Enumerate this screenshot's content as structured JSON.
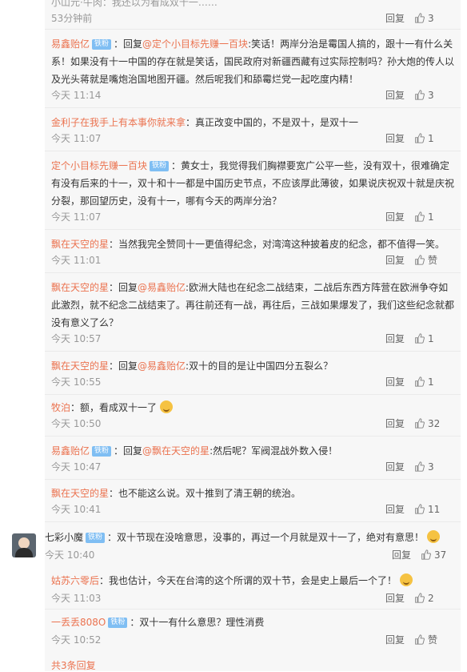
{
  "first": {
    "partial_text": "小山元·牛肉：我还以为看成双十一……",
    "time": "53分钟前",
    "reply": "回复",
    "likes": "3"
  },
  "comments": [
    {
      "user": "易鑫贻亿",
      "badge": "铁粉",
      "prefix": "：回复",
      "mention": "@定个小目标先赚一百块",
      "text": ":笑话！两岸分治是霉国人搞的，跟十一有什么关系！如果没有十一中国的存在就是笑话，国民政府对新疆西藏有过实际控制吗？孙大炮的传人以及光头蒋就是嘴炮治国地图开疆。然后呢我们和舔霉烂党一起吃度内精！",
      "time": "今天 11:14",
      "reply": "回复",
      "likes": "3"
    },
    {
      "user": "金利子在我手上有本事你就来拿",
      "badge": "",
      "prefix": "",
      "mention": "",
      "text": "：真正改变中国的，不是双十，是双十一",
      "time": "今天 11:07",
      "reply": "回复",
      "likes": "1"
    },
    {
      "user": "定个小目标先赚一百块",
      "badge": "铁粉",
      "prefix": "",
      "mention": "",
      "text": "：黄女士，我觉得我们胸襟要宽广公平一些，没有双十，很难确定有没有后来的十一，双十和十一都是中国历史节点，不应该厚此薄彼，如果说庆祝双十就是庆祝分裂，那回望历史，没有十一，哪有今天的两岸分治？",
      "time": "今天 11:07",
      "reply": "回复",
      "likes": "1"
    },
    {
      "user": "飘在天空的星",
      "badge": "",
      "prefix": "",
      "mention": "",
      "text": "：当然我完全赞同十一更值得纪念，对湾湾这种披着皮的纪念，都不值得一笑。",
      "time": "今天 11:01",
      "reply": "回复",
      "likes": "赞"
    },
    {
      "user": "飘在天空的星",
      "badge": "",
      "prefix": "：回复",
      "mention": "@易鑫贻亿",
      "text": ":欧洲大陆也在纪念二战结束，二战后东西方阵营在欧洲争夺如此激烈，就不纪念二战结束了。再往前还有一战，再往后，三战如果爆发了，我们这些纪念就都没有意义了么？",
      "time": "今天 10:57",
      "reply": "回复",
      "likes": "1"
    },
    {
      "user": "飘在天空的星",
      "badge": "",
      "prefix": "：回复",
      "mention": "@易鑫贻亿",
      "text": ":双十的目的是让中国四分五裂么？",
      "time": "今天 10:55",
      "reply": "回复",
      "likes": "1"
    },
    {
      "user": "牧泊",
      "badge": "",
      "prefix": "",
      "mention": "",
      "text": "：额，看成双十一了",
      "time": "今天 10:50",
      "reply": "回复",
      "likes": "32"
    },
    {
      "user": "易鑫贻亿",
      "badge": "铁粉",
      "prefix": "：回复",
      "mention": "@飘在天空的星",
      "text": ":然后呢？军阀混战外数入侵！",
      "time": "今天 10:47",
      "reply": "回复",
      "likes": "3"
    },
    {
      "user": "飘在天空的星",
      "badge": "",
      "prefix": "",
      "mention": "",
      "text": "：也不能这么说。双十推到了清王朝的统治。",
      "time": "今天 10:41",
      "reply": "回复",
      "likes": "11"
    }
  ],
  "main_comment": {
    "user": "七彩小魔",
    "badge": "铁粉",
    "text": "：双十节现在没啥意思，没事的，再过一个月就是双十一了，绝对有意思！",
    "time": "今天 10:40",
    "reply": "回复",
    "likes": "37"
  },
  "sub_comments": [
    {
      "user": "姑苏六零后",
      "badge": "",
      "text": "：我也估计，今天在台湾的这个所谓的双十节，会是史上最后一个了！",
      "time": "今天 11:03",
      "reply": "回复",
      "likes": "2"
    },
    {
      "user": "一丢丢808O",
      "badge": "铁粉",
      "text": "：双十一有什么意思？理性消费",
      "time": "今天 10:52",
      "reply": "回复",
      "likes": "赞"
    }
  ],
  "more_replies": "共3条回复"
}
